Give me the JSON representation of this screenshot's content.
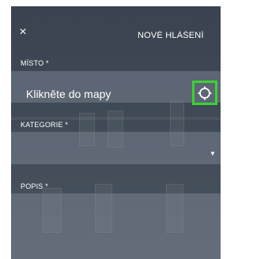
{
  "header": {
    "close_symbol": "×",
    "title": "NOVÉ HLÁŠENÍ"
  },
  "fields": {
    "place": {
      "label": "MÍSTO *",
      "value": "Klikněte do mapy",
      "locate_icon": "crosshair-icon"
    },
    "category": {
      "label": "KATEGORIE *",
      "value": "",
      "arrow": "▼"
    },
    "description": {
      "label": "POPIS *",
      "value": ""
    }
  },
  "colors": {
    "panel_background": "#3f4a56",
    "field_background": "#7a8593",
    "highlight_border": "#39d42f",
    "text": "#ffffff"
  }
}
